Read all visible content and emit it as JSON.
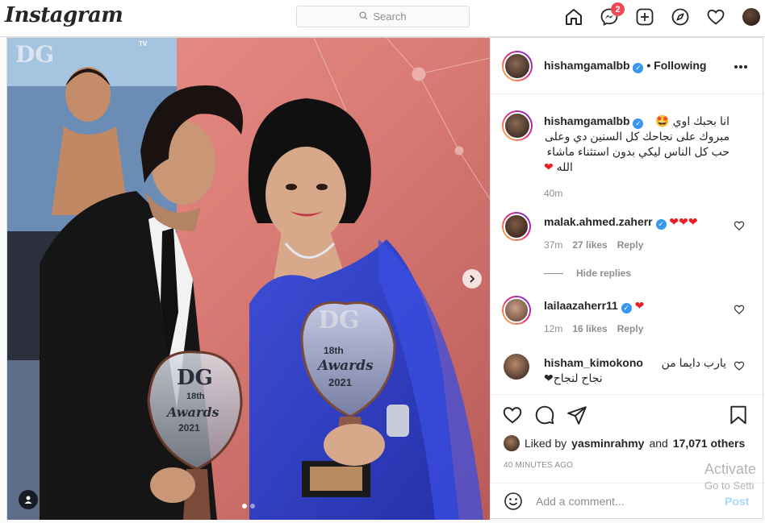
{
  "topbar": {
    "logo": "Instagram",
    "search_placeholder": "Search",
    "messages_badge": "2"
  },
  "post": {
    "author": "hishamgamalbb",
    "follow_status": "• Following",
    "caption_line1": "انا بحبك اوي 🤩",
    "caption_line2": "مبروك على نجاحك كل السنين دي وعلى",
    "caption_line3": "حب كل الناس ليكي بدون استثناء ماشاء",
    "caption_line4": "الله",
    "caption_time": "40m",
    "comments": [
      {
        "user": "malak.ahmed.zaherr",
        "text": "❤❤❤",
        "time": "37m",
        "likes": "27 likes",
        "reply": "Reply"
      },
      {
        "user": "lailaazaherr11",
        "text": "❤",
        "time": "12m",
        "likes": "16 likes",
        "reply": "Reply"
      },
      {
        "user": "hisham_kimokono",
        "text_line1": "يارب دايما من",
        "text_line2": "نجاح لنجاح❤"
      }
    ],
    "hide_replies": "Hide replies",
    "liked_by_prefix": "Liked by",
    "liked_by_user": "yasminrahmy",
    "liked_by_and": "and",
    "liked_by_others": "17,071 others",
    "timestamp": "40 MINUTES AGO",
    "add_comment_placeholder": "Add a comment...",
    "post_button": "Post",
    "carousel_dots": 2
  },
  "overlay": {
    "activate_line1": "Activate",
    "activate_line2": "Go to Setti"
  },
  "photo_text": {
    "dg_top": "DG",
    "dg_award1": "DG",
    "award1_line1": "18th",
    "award1_line2": "Awards",
    "award1_year": "2021",
    "dg_award2": "DG",
    "award2_line1": "18th",
    "award2_line2": "Awards",
    "award2_year": "2021",
    "tv_badge": "TV"
  },
  "colors": {
    "accent": "#0095f6",
    "badge": "#ed4956",
    "verified": "#3897f0"
  }
}
